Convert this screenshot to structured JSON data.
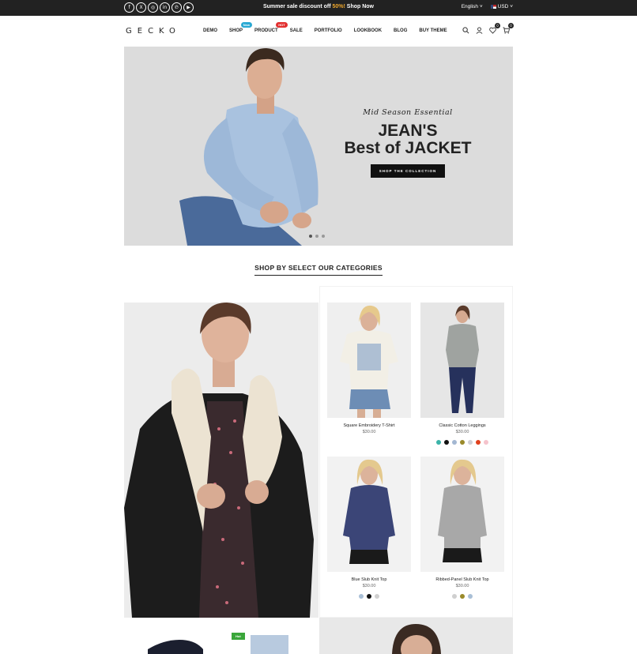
{
  "topbar": {
    "socials": [
      {
        "name": "facebook-icon",
        "glyph": "f"
      },
      {
        "name": "x-icon",
        "glyph": "X"
      },
      {
        "name": "instagram-icon",
        "glyph": "◎"
      },
      {
        "name": "linkedin-icon",
        "glyph": "in"
      },
      {
        "name": "pinterest-icon",
        "glyph": "℗"
      },
      {
        "name": "youtube-icon",
        "glyph": "▶"
      }
    ],
    "promo_prefix": "Summer sale discount off ",
    "promo_pct": "50%!",
    "promo_link": " Shop Now",
    "language": "English",
    "currency": "USD"
  },
  "header": {
    "logo": "GECKO",
    "nav": [
      {
        "label": "DEMO"
      },
      {
        "label": "SHOP",
        "badge": "New",
        "badge_type": "new"
      },
      {
        "label": "PRODUCT",
        "badge": "HOT",
        "badge_type": "hot"
      },
      {
        "label": "SALE"
      },
      {
        "label": "PORTFOLIO"
      },
      {
        "label": "LOOKBOOK"
      },
      {
        "label": "BLOG"
      },
      {
        "label": "BUY THEME"
      }
    ],
    "wishlist_count": "0",
    "cart_count": "0"
  },
  "hero": {
    "subtitle": "Mid Season Essential",
    "title1": "JEAN'S",
    "title2": "Best of JACKET",
    "button": "SHOP THE COLLECTION"
  },
  "section": {
    "title": "SHOP BY SELECT OUR CATEGORIES"
  },
  "products": [
    {
      "name": "Square Embroidery T-Shirt",
      "price": "$30.00",
      "swatches": []
    },
    {
      "name": "Classic Cotton Leggings",
      "price": "$30.00",
      "swatches": [
        "#3bb3a8",
        "#111111",
        "#a3b7d2",
        "#9a8a2a",
        "#cfcfd6",
        "#e0411e",
        "#f5c3cc"
      ]
    },
    {
      "name": "Blue Slub Knit Top",
      "price": "$30.00",
      "swatches": [
        "#a9bfd6",
        "#111111",
        "#d0d0d0"
      ]
    },
    {
      "name": "Ribbed-Panel Slub Knit Top",
      "price": "$30.00",
      "swatches": [
        "#cfcfcf",
        "#9a8a2a",
        "#a9bfd6"
      ]
    }
  ],
  "bottom": {
    "badge": "Hot"
  },
  "colors": {
    "topbar_bg": "#222222",
    "accent_new": "#2aa9d3",
    "accent_hot": "#e23030",
    "promo_highlight": "#f0a82c"
  }
}
